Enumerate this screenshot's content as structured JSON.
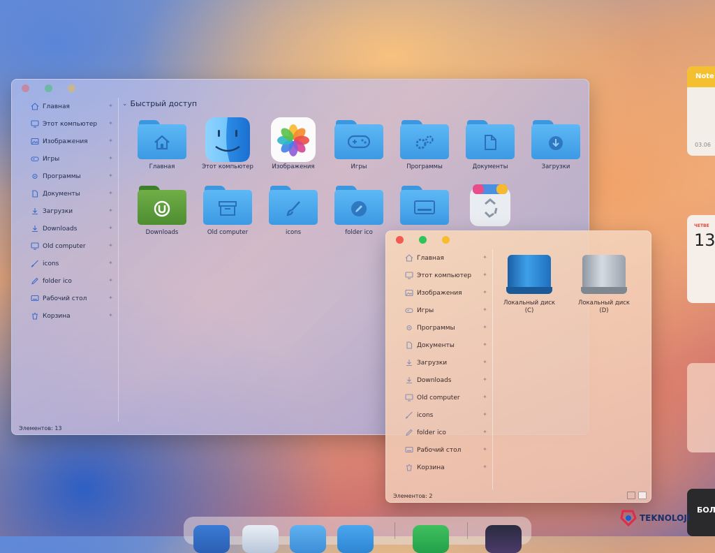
{
  "explorer_main": {
    "section_title": "Быстрый доступ",
    "sidebar": [
      {
        "label": "Главная",
        "icon": "home-icon"
      },
      {
        "label": "Этот компьютер",
        "icon": "computer-icon"
      },
      {
        "label": "Изображения",
        "icon": "images-icon"
      },
      {
        "label": "Игры",
        "icon": "gamepad-icon"
      },
      {
        "label": "Программы",
        "icon": "gears-icon"
      },
      {
        "label": "Документы",
        "icon": "document-icon"
      },
      {
        "label": "Загрузки",
        "icon": "download-icon"
      },
      {
        "label": "Downloads",
        "icon": "download-icon"
      },
      {
        "label": "Old computer",
        "icon": "computer-icon"
      },
      {
        "label": "icons",
        "icon": "brush-icon"
      },
      {
        "label": "folder ico",
        "icon": "pencil-icon"
      },
      {
        "label": "Рабочий стол",
        "icon": "desktop-icon"
      },
      {
        "label": "Корзина",
        "icon": "recycle-bin-icon"
      }
    ],
    "items": [
      {
        "label": "Главная",
        "icon": "home-folder-icon"
      },
      {
        "label": "Этот компьютер",
        "icon": "finder-icon"
      },
      {
        "label": "Изображения",
        "icon": "photos-icon"
      },
      {
        "label": "Игры",
        "icon": "gamepad-folder-icon"
      },
      {
        "label": "Программы",
        "icon": "gears-folder-icon"
      },
      {
        "label": "Документы",
        "icon": "document-folder-icon"
      },
      {
        "label": "Загрузки",
        "icon": "download-folder-icon"
      },
      {
        "label": "Downloads",
        "icon": "utorrent-folder-icon"
      },
      {
        "label": "Old computer",
        "icon": "archive-folder-icon"
      },
      {
        "label": "icons",
        "icon": "brush-folder-icon"
      },
      {
        "label": "folder ico",
        "icon": "pencil-folder-icon"
      },
      {
        "label": "",
        "icon": "desktop-folder-icon"
      },
      {
        "label": "",
        "icon": "recycle-bin-icon"
      }
    ],
    "status": "Элементов: 13"
  },
  "explorer_computer": {
    "sidebar": [
      {
        "label": "Главная",
        "icon": "home-icon"
      },
      {
        "label": "Этот компьютер",
        "icon": "computer-icon"
      },
      {
        "label": "Изображения",
        "icon": "images-icon"
      },
      {
        "label": "Игры",
        "icon": "gamepad-icon"
      },
      {
        "label": "Программы",
        "icon": "gears-icon"
      },
      {
        "label": "Документы",
        "icon": "document-icon"
      },
      {
        "label": "Загрузки",
        "icon": "download-icon"
      },
      {
        "label": "Downloads",
        "icon": "download-icon"
      },
      {
        "label": "Old computer",
        "icon": "computer-icon"
      },
      {
        "label": "icons",
        "icon": "brush-icon"
      },
      {
        "label": "folder ico",
        "icon": "pencil-icon"
      },
      {
        "label": "Рабочий стол",
        "icon": "desktop-icon"
      },
      {
        "label": "Корзина",
        "icon": "recycle-bin-icon"
      }
    ],
    "drives": [
      {
        "label_line1": "Локальный диск",
        "label_line2": "(C)",
        "color": "#2a8ad6"
      },
      {
        "label_line1": "Локальный диск",
        "label_line2": "(D)",
        "color": "#b8c0c8"
      }
    ],
    "status": "Элементов: 2"
  },
  "widgets": {
    "notes_title": "Note",
    "notes_date": "03.06",
    "calendar_day": "ЧЕТВЕ",
    "calendar_number": "13",
    "dark_text": "БОЛ"
  },
  "watermark": "TEKNOLOJİ",
  "colors": {
    "folder_blue": "#4fadf0",
    "folder_green": "#5b9b3b",
    "close": "#f25a52",
    "maximize": "#2fc45a",
    "minimize": "#f6bd2c",
    "notes_yellow": "#f5c02f",
    "calendar_red": "#e3443b"
  }
}
